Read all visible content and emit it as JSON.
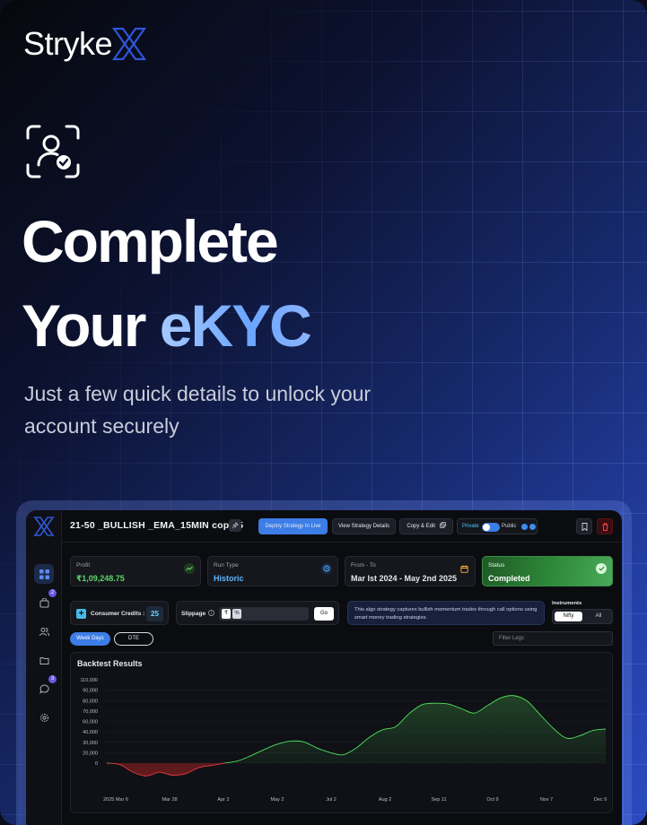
{
  "brand": {
    "name": "Stryke",
    "x_glyph": "X"
  },
  "hero": {
    "icon": "face-verify-icon",
    "headline_line1": "Complete",
    "headline_line2_plain": "Your ",
    "headline_line2_accent": "eKYC",
    "subtitle": "Just a few quick details to unlock your account securely"
  },
  "app": {
    "strategy_title": "21-50 _BULLISH _EMA_15MIN copy-5",
    "buttons": {
      "deploy": "Deploy Strategy In Live",
      "view": "View Strategy Details",
      "copy": "Copy & Edit"
    },
    "visibility": {
      "private": "Private",
      "public": "Public"
    },
    "sidebar_badges": {
      "cart": "2",
      "chat": "3"
    },
    "cards": [
      {
        "label": "Profit",
        "value": "₹1,09,248.75",
        "color": "#5fd66a"
      },
      {
        "label": "Run Type",
        "value": "Historic",
        "color": "#5fb4ff"
      },
      {
        "label": "From - To",
        "value": "Mar Ist 2024 - May 2nd 2025",
        "color": "#e6e8ee"
      },
      {
        "label": "Status",
        "value": "Completed",
        "color": "#ffffff"
      }
    ],
    "credits": {
      "label": "Consumer Credits :",
      "value": "25"
    },
    "slippage": {
      "label": "Slippage",
      "currency": "₹",
      "percent": "%",
      "go": "Go"
    },
    "description": "This algo strategy captures bullish momentum trades through call options using smart money trading strategies.",
    "instruments": {
      "label": "Instruments",
      "options": [
        "Nifty",
        "All"
      ],
      "selected": "Nifty"
    },
    "day_filters": [
      "Week Days",
      "DTE"
    ],
    "filter_placeholder": "Filter Legs"
  },
  "chart_data": {
    "type": "area",
    "title": "Backtest Results",
    "y_ticks": [
      "110,000",
      "90,000",
      "80,000",
      "70,000",
      "60,000",
      "40,000",
      "30,000",
      "20,000",
      "0"
    ],
    "x_ticks": [
      "2025 Mar 6",
      "Mar 28",
      "Apr 2",
      "May 2",
      "Jul 2",
      "Aug 2",
      "Sep 11",
      "Oct 9",
      "Nov 7",
      "Dec 9"
    ],
    "series": [
      {
        "values": [
          0,
          -2000,
          -12000,
          -17000,
          -12000,
          -16000,
          -14000,
          -6000,
          -3000,
          0,
          3000,
          10000,
          18000,
          25000,
          29000,
          28000,
          20000,
          14000,
          11000,
          20000,
          34000,
          44000,
          48000,
          65000,
          77000,
          79000,
          78000,
          72000,
          66000,
          76000,
          86000,
          89000,
          82000,
          64000,
          46000,
          33000,
          36000,
          43000,
          45000
        ]
      }
    ],
    "colors": {
      "positive": "#4ee05a",
      "negative": "#e23a3a"
    }
  }
}
